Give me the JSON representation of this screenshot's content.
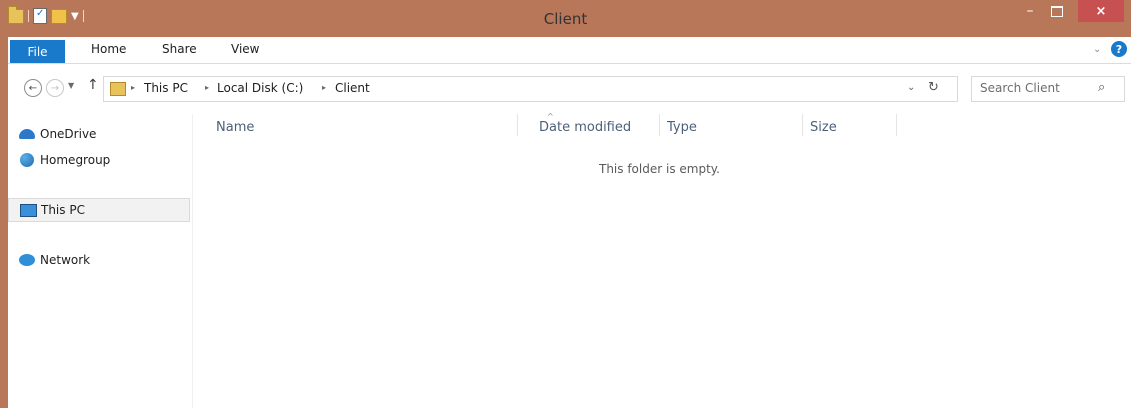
{
  "window": {
    "title": "Client",
    "close_symbol": "×",
    "minimize_symbol": "–"
  },
  "ribbon": {
    "tabs": [
      "File",
      "Home",
      "Share",
      "View"
    ],
    "expand_symbol": "⌄",
    "help_symbol": "?"
  },
  "navigation": {
    "back_symbol": "←",
    "forward_symbol": "→",
    "recent_symbol": "▼",
    "up_symbol": "↑",
    "dropdown_symbol": "⌄",
    "refresh_symbol": "↻"
  },
  "address": {
    "crumbs": [
      "This PC",
      "Local Disk (C:)",
      "Client"
    ],
    "separator": "▸"
  },
  "search": {
    "placeholder": "Search Client",
    "icon_symbol": "⌕"
  },
  "nav_pane": {
    "items": [
      {
        "label": "OneDrive",
        "icon": "onedrive-icon"
      },
      {
        "label": "Homegroup",
        "icon": "homegroup-icon"
      },
      {
        "label": "This PC",
        "icon": "this-pc-icon"
      },
      {
        "label": "Network",
        "icon": "network-icon"
      }
    ]
  },
  "file_list": {
    "columns": [
      "Name",
      "Date modified",
      "Type",
      "Size"
    ],
    "sort_symbol": "^",
    "empty_message": "This folder is empty."
  },
  "colors": {
    "titlebar": "#b9775a",
    "accent": "#1979ca",
    "close_button": "#c75050"
  }
}
